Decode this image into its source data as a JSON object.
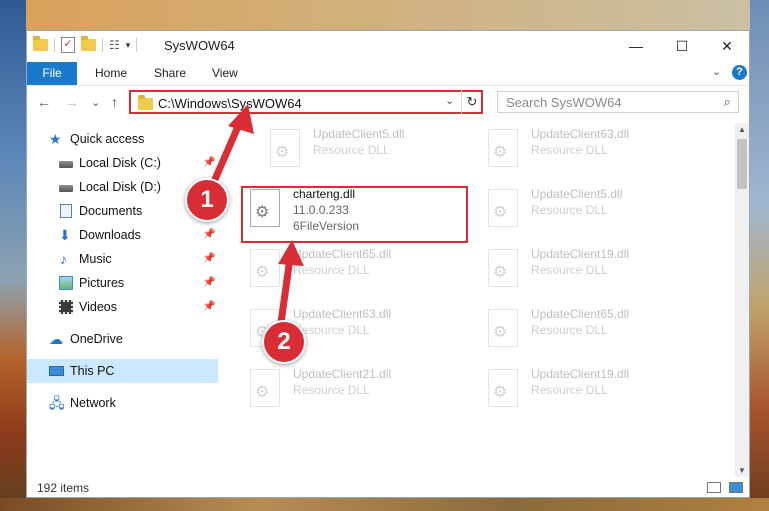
{
  "window": {
    "title": "SysWOW64",
    "minimize": "—",
    "maximize": "☐",
    "close": "✕"
  },
  "ribbon": {
    "tabs": [
      "File",
      "Home",
      "Share",
      "View"
    ],
    "help": "?",
    "expand": "⌄"
  },
  "nav": {
    "back": "←",
    "forward": "→",
    "recent": "⌄",
    "up": "↑"
  },
  "address": {
    "path": "C:\\Windows\\SysWOW64",
    "dropdown": "⌄",
    "refresh": "↻"
  },
  "search": {
    "placeholder": "Search SysWOW64",
    "icon": "search-icon"
  },
  "sidebar": {
    "items": [
      {
        "label": "Quick access",
        "icon": "star-icon"
      },
      {
        "label": "Local Disk (C:)",
        "icon": "disk-icon",
        "pinned": true
      },
      {
        "label": "Local Disk (D:)",
        "icon": "disk-icon",
        "pinned": true
      },
      {
        "label": "Documents",
        "icon": "documents-icon",
        "pinned": true
      },
      {
        "label": "Downloads",
        "icon": "downloads-icon",
        "pinned": true
      },
      {
        "label": "Music",
        "icon": "music-icon",
        "pinned": true
      },
      {
        "label": "Pictures",
        "icon": "pictures-icon",
        "pinned": true
      },
      {
        "label": "Videos",
        "icon": "videos-icon",
        "pinned": true
      },
      {
        "label": "OneDrive",
        "icon": "onedrive-icon"
      },
      {
        "label": "This PC",
        "icon": "this-pc-icon",
        "selected": true
      },
      {
        "label": "Network",
        "icon": "network-icon"
      }
    ]
  },
  "files": {
    "left_column": [
      {
        "name": "UpdateClient5.dll",
        "desc": "Resource DLL"
      },
      {
        "name": "charteng.dll",
        "desc": "11.0.0.233",
        "version": "6FileVersion",
        "highlighted": true
      },
      {
        "name": "UpdateClient65.dll",
        "desc": "Resource DLL"
      },
      {
        "name": "UpdateClient63.dll",
        "desc": "Resource DLL"
      },
      {
        "name": "UpdateClient21.dll",
        "desc": "Resource DLL"
      }
    ],
    "right_column": [
      {
        "name": "UpdateClient63.dll",
        "desc": "Resource DLL"
      },
      {
        "name": "UpdateClient5.dll",
        "desc": "Resource DLL"
      },
      {
        "name": "UpdateClient19.dll",
        "desc": "Resource DLL"
      },
      {
        "name": "UpdateClient65.dll",
        "desc": "Resource DLL"
      },
      {
        "name": "UpdateClient19.dll",
        "desc": "Resource DLL"
      }
    ]
  },
  "status": {
    "count": "192 items"
  },
  "annotations": {
    "badge1": "1",
    "badge2": "2",
    "color": "#d92d36"
  }
}
